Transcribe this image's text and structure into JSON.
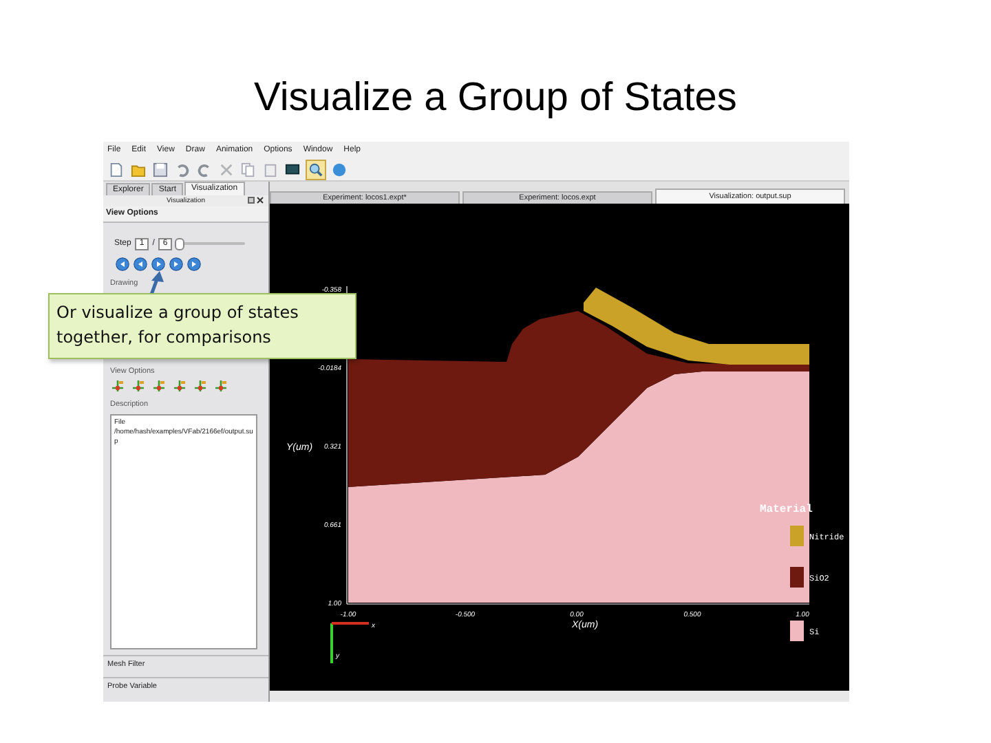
{
  "slide_title": "Visualize a Group of States",
  "menu": [
    "File",
    "Edit",
    "View",
    "Draw",
    "Animation",
    "Options",
    "Window",
    "Help"
  ],
  "toolbar": [
    {
      "selected": false
    },
    {
      "selected": false
    },
    {
      "selected": false
    },
    {
      "selected": false
    },
    {
      "selected": false
    },
    {
      "selected": false
    },
    {
      "selected": false
    },
    {
      "selected": false
    },
    {
      "selected": false
    },
    {
      "selected": true
    },
    {
      "selected": false
    }
  ],
  "left_tabs": [
    {
      "label": "Explorer",
      "selected": false
    },
    {
      "label": "Start",
      "selected": false
    },
    {
      "label": "Visualization",
      "selected": true
    }
  ],
  "panel": {
    "title": "Visualization",
    "section": "View Options",
    "step_label": "Step",
    "step_value": "1",
    "separator": "/",
    "step_total": "6",
    "level": 0,
    "drawing_label": "Drawing",
    "view_options_label": "View Options",
    "description_label": "Description",
    "description_lines": [
      "File",
      "/home/hash/examples/VFab/2166ef/output.sup"
    ],
    "bottom_sections": [
      "Mesh Filter",
      "Probe Variable"
    ]
  },
  "doc_tabs": [
    {
      "label": "Experiment: locos1.expt*",
      "selected": false
    },
    {
      "label": "Experiment: locos.expt",
      "selected": false
    },
    {
      "label": "Visualization: output.sup",
      "selected": true
    }
  ],
  "plot": {
    "y_ticks": [
      "-0.358",
      "-0.0184",
      "0.321",
      "0.661",
      "1.00"
    ],
    "x_ticks": [
      "-1.00",
      "-0.500",
      "0.00",
      "0.500",
      "1.00"
    ],
    "x_label": "X(um)",
    "y_label": "Y(um)",
    "triad": [
      "x",
      "y"
    ],
    "legend_title": "Material",
    "legend": [
      {
        "label": "Nitride",
        "color": "#c9a227"
      },
      {
        "label": "SiO2",
        "color": "#6e1a10"
      },
      {
        "label": "Si",
        "color": "#f0b8bf"
      }
    ]
  },
  "callout": "Or visualize a group of states together, for comparisons"
}
